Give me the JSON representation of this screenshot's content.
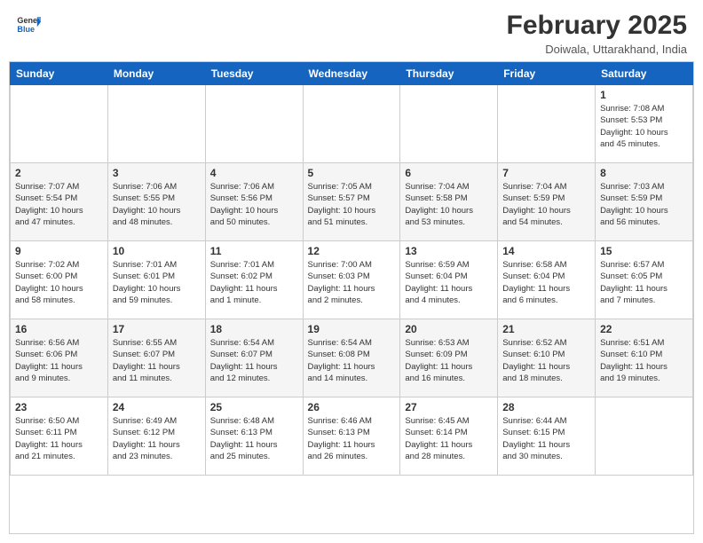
{
  "header": {
    "logo_general": "General",
    "logo_blue": "Blue",
    "month_title": "February 2025",
    "subtitle": "Doiwala, Uttarakhand, India"
  },
  "weekdays": [
    "Sunday",
    "Monday",
    "Tuesday",
    "Wednesday",
    "Thursday",
    "Friday",
    "Saturday"
  ],
  "weeks": [
    [
      {
        "day": "",
        "detail": ""
      },
      {
        "day": "",
        "detail": ""
      },
      {
        "day": "",
        "detail": ""
      },
      {
        "day": "",
        "detail": ""
      },
      {
        "day": "",
        "detail": ""
      },
      {
        "day": "",
        "detail": ""
      },
      {
        "day": "1",
        "detail": "Sunrise: 7:08 AM\nSunset: 5:53 PM\nDaylight: 10 hours\nand 45 minutes."
      }
    ],
    [
      {
        "day": "2",
        "detail": "Sunrise: 7:07 AM\nSunset: 5:54 PM\nDaylight: 10 hours\nand 47 minutes."
      },
      {
        "day": "3",
        "detail": "Sunrise: 7:06 AM\nSunset: 5:55 PM\nDaylight: 10 hours\nand 48 minutes."
      },
      {
        "day": "4",
        "detail": "Sunrise: 7:06 AM\nSunset: 5:56 PM\nDaylight: 10 hours\nand 50 minutes."
      },
      {
        "day": "5",
        "detail": "Sunrise: 7:05 AM\nSunset: 5:57 PM\nDaylight: 10 hours\nand 51 minutes."
      },
      {
        "day": "6",
        "detail": "Sunrise: 7:04 AM\nSunset: 5:58 PM\nDaylight: 10 hours\nand 53 minutes."
      },
      {
        "day": "7",
        "detail": "Sunrise: 7:04 AM\nSunset: 5:59 PM\nDaylight: 10 hours\nand 54 minutes."
      },
      {
        "day": "8",
        "detail": "Sunrise: 7:03 AM\nSunset: 5:59 PM\nDaylight: 10 hours\nand 56 minutes."
      }
    ],
    [
      {
        "day": "9",
        "detail": "Sunrise: 7:02 AM\nSunset: 6:00 PM\nDaylight: 10 hours\nand 58 minutes."
      },
      {
        "day": "10",
        "detail": "Sunrise: 7:01 AM\nSunset: 6:01 PM\nDaylight: 10 hours\nand 59 minutes."
      },
      {
        "day": "11",
        "detail": "Sunrise: 7:01 AM\nSunset: 6:02 PM\nDaylight: 11 hours\nand 1 minute."
      },
      {
        "day": "12",
        "detail": "Sunrise: 7:00 AM\nSunset: 6:03 PM\nDaylight: 11 hours\nand 2 minutes."
      },
      {
        "day": "13",
        "detail": "Sunrise: 6:59 AM\nSunset: 6:04 PM\nDaylight: 11 hours\nand 4 minutes."
      },
      {
        "day": "14",
        "detail": "Sunrise: 6:58 AM\nSunset: 6:04 PM\nDaylight: 11 hours\nand 6 minutes."
      },
      {
        "day": "15",
        "detail": "Sunrise: 6:57 AM\nSunset: 6:05 PM\nDaylight: 11 hours\nand 7 minutes."
      }
    ],
    [
      {
        "day": "16",
        "detail": "Sunrise: 6:56 AM\nSunset: 6:06 PM\nDaylight: 11 hours\nand 9 minutes."
      },
      {
        "day": "17",
        "detail": "Sunrise: 6:55 AM\nSunset: 6:07 PM\nDaylight: 11 hours\nand 11 minutes."
      },
      {
        "day": "18",
        "detail": "Sunrise: 6:54 AM\nSunset: 6:07 PM\nDaylight: 11 hours\nand 12 minutes."
      },
      {
        "day": "19",
        "detail": "Sunrise: 6:54 AM\nSunset: 6:08 PM\nDaylight: 11 hours\nand 14 minutes."
      },
      {
        "day": "20",
        "detail": "Sunrise: 6:53 AM\nSunset: 6:09 PM\nDaylight: 11 hours\nand 16 minutes."
      },
      {
        "day": "21",
        "detail": "Sunrise: 6:52 AM\nSunset: 6:10 PM\nDaylight: 11 hours\nand 18 minutes."
      },
      {
        "day": "22",
        "detail": "Sunrise: 6:51 AM\nSunset: 6:10 PM\nDaylight: 11 hours\nand 19 minutes."
      }
    ],
    [
      {
        "day": "23",
        "detail": "Sunrise: 6:50 AM\nSunset: 6:11 PM\nDaylight: 11 hours\nand 21 minutes."
      },
      {
        "day": "24",
        "detail": "Sunrise: 6:49 AM\nSunset: 6:12 PM\nDaylight: 11 hours\nand 23 minutes."
      },
      {
        "day": "25",
        "detail": "Sunrise: 6:48 AM\nSunset: 6:13 PM\nDaylight: 11 hours\nand 25 minutes."
      },
      {
        "day": "26",
        "detail": "Sunrise: 6:46 AM\nSunset: 6:13 PM\nDaylight: 11 hours\nand 26 minutes."
      },
      {
        "day": "27",
        "detail": "Sunrise: 6:45 AM\nSunset: 6:14 PM\nDaylight: 11 hours\nand 28 minutes."
      },
      {
        "day": "28",
        "detail": "Sunrise: 6:44 AM\nSunset: 6:15 PM\nDaylight: 11 hours\nand 30 minutes."
      },
      {
        "day": "",
        "detail": ""
      }
    ]
  ]
}
